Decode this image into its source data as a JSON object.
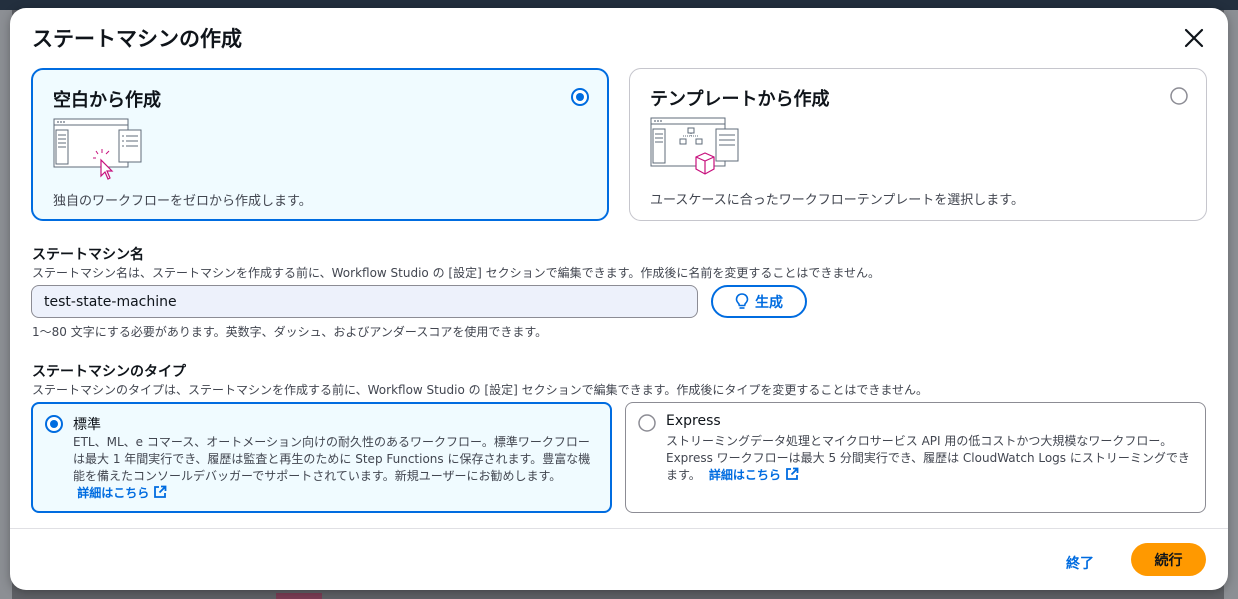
{
  "modal": {
    "title": "ステートマシンの作成"
  },
  "creation_options": [
    {
      "title": "空白から作成",
      "description": "独自のワークフローをゼロから作成します。",
      "selected": true
    },
    {
      "title": "テンプレートから作成",
      "description": "ユースケースに合ったワークフローテンプレートを選択します。",
      "selected": false
    }
  ],
  "name_section": {
    "label": "ステートマシン名",
    "description": "ステートマシン名は、ステートマシンを作成する前に、Workflow Studio の [設定] セクションで編集できます。作成後に名前を変更することはできません。",
    "value": "test-state-machine",
    "generate_label": "生成",
    "constraint": "1〜80 文字にする必要があります。英数字、ダッシュ、およびアンダースコアを使用できます。"
  },
  "type_section": {
    "label": "ステートマシンのタイプ",
    "description": "ステートマシンのタイプは、ステートマシンを作成する前に、Workflow Studio の [設定] セクションで編集できます。作成後にタイプを変更することはできません。",
    "types": [
      {
        "title": "標準",
        "description": "ETL、ML、e コマース、オートメーション向けの耐久性のあるワークフロー。標準ワークフローは最大 1 年間実行でき、履歴は監査と再生のために Step Functions に保存されます。豊富な機能を備えたコンソールデバッガーでサポートされています。新規ユーザーにお勧めします。",
        "learn_more": "詳細はこちら",
        "selected": true
      },
      {
        "title": "Express",
        "description": "ストリーミングデータ処理とマイクロサービス API 用の低コストかつ大規模なワークフロー。Express ワークフローは最大 5 分間実行でき、履歴は CloudWatch Logs にストリーミングできます。",
        "learn_more": "詳細はこちら",
        "selected": false
      }
    ]
  },
  "footer": {
    "cancel_label": "終了",
    "continue_label": "続行"
  },
  "colors": {
    "accent": "#006ce0",
    "primary_button": "#ff9900",
    "selected_bg": "#f0fbff"
  }
}
